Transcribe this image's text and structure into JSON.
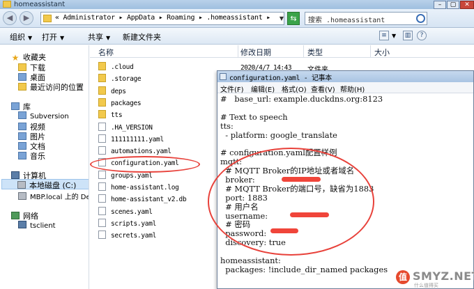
{
  "explorer": {
    "window_title": "homeassistant",
    "address_path": "« Administrator ▸ AppData ▸ Roaming ▸ .homeassistant ▸",
    "search_placeholder": "搜索 .homeassistant",
    "toolbar": {
      "organize": "组织",
      "open": "打开",
      "share": "共享",
      "new_folder": "新建文件夹"
    },
    "columns": {
      "name": "名称",
      "modified": "修改日期",
      "type": "类型",
      "size": "大小"
    },
    "nav": {
      "favorites": "收藏夹",
      "downloads": "下载",
      "desktop": "桌面",
      "recent": "最近访问的位置",
      "libraries": "库",
      "subversion": "Subversion",
      "videos": "视频",
      "pictures": "图片",
      "documents": "文档",
      "music": "音乐",
      "computer": "计算机",
      "local_disk": "本地磁盘 (C:)",
      "mbp": "MBP.local 上的 Des",
      "network": "网络",
      "tsclient": "tsclient"
    },
    "first_row_date": "2020/4/7 14:43",
    "first_row_type": "文件夹",
    "files": [
      {
        "name": ".cloud",
        "kind": "folder"
      },
      {
        "name": ".storage",
        "kind": "folder"
      },
      {
        "name": "deps",
        "kind": "folder"
      },
      {
        "name": "packages",
        "kind": "folder"
      },
      {
        "name": "tts",
        "kind": "folder"
      },
      {
        "name": ".HA_VERSION",
        "kind": "doc"
      },
      {
        "name": "111111111.yaml",
        "kind": "doc"
      },
      {
        "name": "automations.yaml",
        "kind": "doc"
      },
      {
        "name": "configuration.yaml",
        "kind": "doc"
      },
      {
        "name": "groups.yaml",
        "kind": "doc"
      },
      {
        "name": "home-assistant.log",
        "kind": "doc"
      },
      {
        "name": "home-assistant_v2.db",
        "kind": "doc"
      },
      {
        "name": "scenes.yaml",
        "kind": "doc"
      },
      {
        "name": "scripts.yaml",
        "kind": "doc"
      },
      {
        "name": "secrets.yaml",
        "kind": "doc"
      }
    ]
  },
  "notepad": {
    "title": "configuration.yaml - 记事本",
    "menu": {
      "file": "文件(F)",
      "edit": "编辑(E)",
      "format": "格式(O)",
      "view": "查看(V)",
      "help": "帮助(H)"
    },
    "lines": [
      "#   base_url: example.duckdns.org:8123",
      "",
      "# Text to speech",
      "tts:",
      "  - platform: google_translate",
      "",
      "# configuration.yaml配置样例",
      "mqtt:",
      "  # MQTT Broker的IP地址或者域名",
      "  broker:",
      "  # MQTT Broker的端口号，缺省为1883",
      "  port: 1883",
      "  # 用户名",
      "  username:",
      "  # 密码",
      "  password:",
      "  discovery: true",
      "",
      "homeassistant:",
      "  packages: !include_dir_named packages"
    ]
  },
  "watermark": {
    "badge": "值",
    "brand": "SMYZ.NET",
    "sub": "什么值得买"
  },
  "colors": {
    "highlight": "#e8413a",
    "titlebar": "#b9d1ea"
  }
}
